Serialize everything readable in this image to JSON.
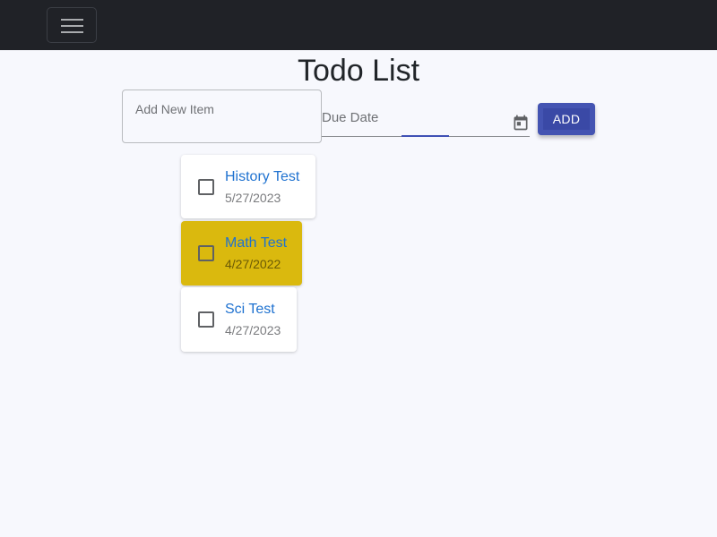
{
  "navbar": {
    "menu_icon": "hamburger-menu-icon"
  },
  "page": {
    "title": "Todo List"
  },
  "form": {
    "new_item_placeholder": "Add New Item",
    "due_date_label": "Due Date",
    "calendar_icon": "calendar-icon",
    "add_label": "ADD"
  },
  "todos": [
    {
      "name": "History Test",
      "date": "5/27/2023",
      "checked": false,
      "highlighted": false
    },
    {
      "name": "Math Test",
      "date": "4/27/2022",
      "checked": false,
      "highlighted": true
    },
    {
      "name": "Sci Test",
      "date": "4/27/2023",
      "checked": false,
      "highlighted": false
    }
  ],
  "colors": {
    "navbar": "#202227",
    "background": "#f7f8fd",
    "accent": "#3f51b5",
    "highlight": "#dab90e",
    "link": "#1f72d0"
  }
}
